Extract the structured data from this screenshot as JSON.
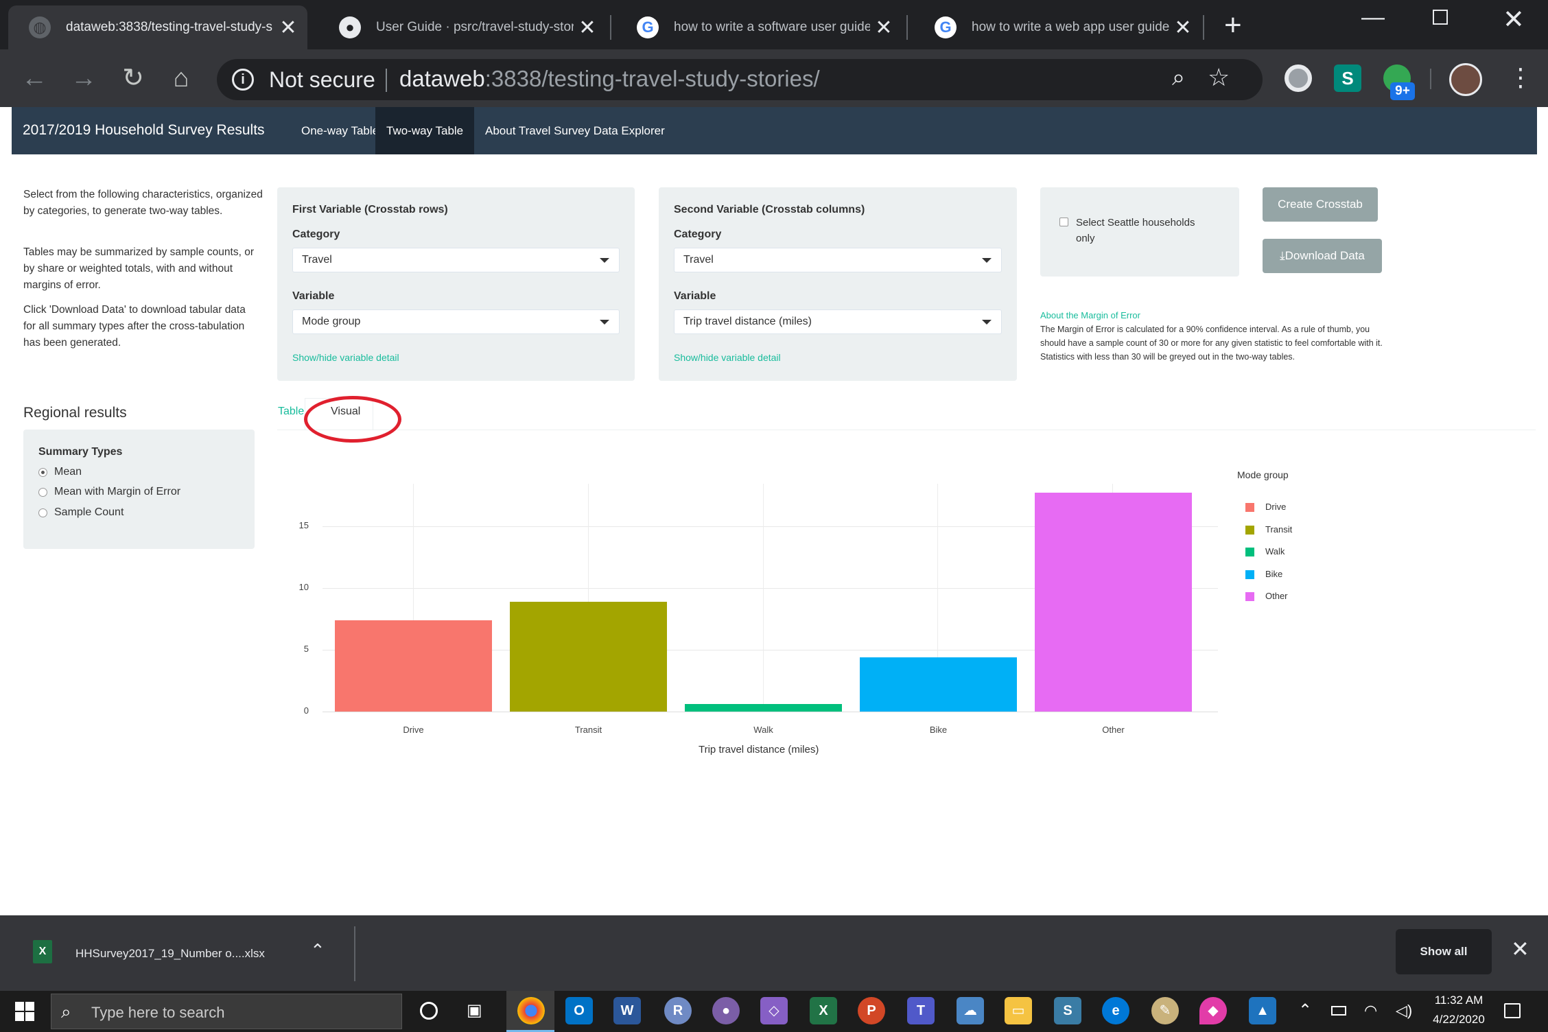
{
  "browser": {
    "tabs": [
      {
        "title": "dataweb:3838/testing-travel-study-s",
        "icon": "globe-icon"
      },
      {
        "title": "User Guide · psrc/travel-study-storie",
        "icon": "github-icon"
      },
      {
        "title": "how to write a software user guide -",
        "icon": "google-icon"
      },
      {
        "title": "how to write a web app user guide -",
        "icon": "google-icon"
      }
    ],
    "security": "Not secure",
    "url_host": "dataweb",
    "url_rest": ":3838/testing-travel-study-stories/",
    "ext_badge": "9+"
  },
  "app": {
    "brand": "2017/2019 Household Survey Results",
    "nav": [
      "One-way Table",
      "Two-way Table",
      "About Travel Survey Data Explorer"
    ],
    "intro": [
      "Select from the following characteristics, organized by categories, to generate two-way tables.",
      "Tables may be summarized by sample counts, or by share or weighted totals, with and without margins of error.",
      "Click 'Download Data' to download tabular data for all summary types after the cross-tabulation has been generated."
    ],
    "first": {
      "title": "First Variable (Crosstab rows)",
      "category_label": "Category",
      "category": "Travel",
      "variable_label": "Variable",
      "variable": "Mode group",
      "detail_link": "Show/hide variable detail"
    },
    "second": {
      "title": "Second Variable (Crosstab columns)",
      "category_label": "Category",
      "category": "Travel",
      "variable_label": "Variable",
      "variable": "Trip travel distance (miles)",
      "detail_link": "Show/hide variable detail"
    },
    "seattle_checkbox": "Select Seattle households only",
    "create_btn": "Create Crosstab",
    "download_btn": "Download Data",
    "moe_title": "About the Margin of Error",
    "moe_text": "The Margin of Error is calculated for a 90% confidence interval. As a rule of thumb, you should have a sample count of 30 or more for any given statistic to feel comfortable with it. Statistics with less than 30 will be greyed out in the two-way tables.",
    "regional_title": "Regional results",
    "summary_title": "Summary Types",
    "summary_options": [
      "Mean",
      "Mean with Margin of Error",
      "Sample Count"
    ],
    "summary_selected": "Mean",
    "result_tabs": [
      "Table",
      "Visual"
    ],
    "active_result_tab": "Visual"
  },
  "chart_data": {
    "type": "bar",
    "categories": [
      "Drive",
      "Transit",
      "Walk",
      "Bike",
      "Other"
    ],
    "values": [
      7.4,
      8.9,
      0.6,
      4.4,
      17.7
    ],
    "colors": [
      "#f8766d",
      "#a3a500",
      "#00bf7d",
      "#00b0f6",
      "#e76bf3"
    ],
    "xlabel": "Trip travel distance (miles)",
    "ylabel": "",
    "ylim": [
      0,
      19
    ],
    "yticks": [
      0,
      5,
      10,
      15
    ],
    "legend_title": "Mode group",
    "legend_position": "right",
    "grid": true
  },
  "download": {
    "filename": "HHSurvey2017_19_Number o....xlsx",
    "show_all": "Show all"
  },
  "taskbar": {
    "search_placeholder": "Type here to search",
    "time": "11:32 AM",
    "date": "4/22/2020"
  }
}
